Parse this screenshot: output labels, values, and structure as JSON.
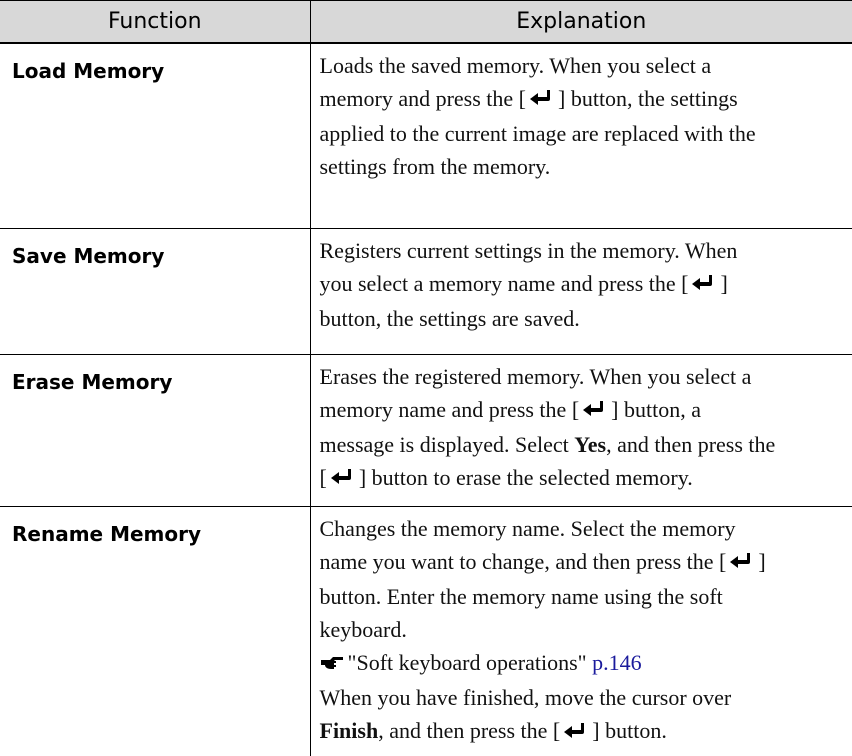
{
  "table": {
    "headers": [
      "Function",
      "Explanation"
    ],
    "rows": [
      {
        "function": "Load Memory",
        "lines": [
          "Loads the saved memory. When you select a",
          "memory and press the [",
          "] button, the settings",
          "applied to the current image are replaced with the",
          "settings from the memory."
        ]
      },
      {
        "function": "Save Memory",
        "lines": [
          "Registers current settings in the memory. When",
          "you select a memory name and press the [",
          "]",
          "button, the settings are saved."
        ]
      },
      {
        "function": "Erase Memory",
        "lines": [
          "Erases the registered memory. When you select a",
          "memory name and press the [",
          "] button, a",
          "message is displayed. Select ",
          "Yes",
          ", and then press the",
          "[",
          "] button to erase the selected memory."
        ]
      },
      {
        "function": "Rename Memory",
        "lines": [
          "Changes the memory name. Select the memory",
          "name you want to change, and then press the [",
          "]",
          "button. Enter the memory name using the soft",
          "keyboard.",
          "\"Soft keyboard operations\" ",
          "p.146",
          "When you have finished, move the cursor over",
          "Finish",
          ", and then press the [",
          "] button."
        ]
      }
    ]
  },
  "icons": {
    "enter_key": "enter-key-icon",
    "pointer": "pointing-hand-icon"
  },
  "colors": {
    "header_bg": "#d8d8d8",
    "link": "#1a1a9c"
  }
}
